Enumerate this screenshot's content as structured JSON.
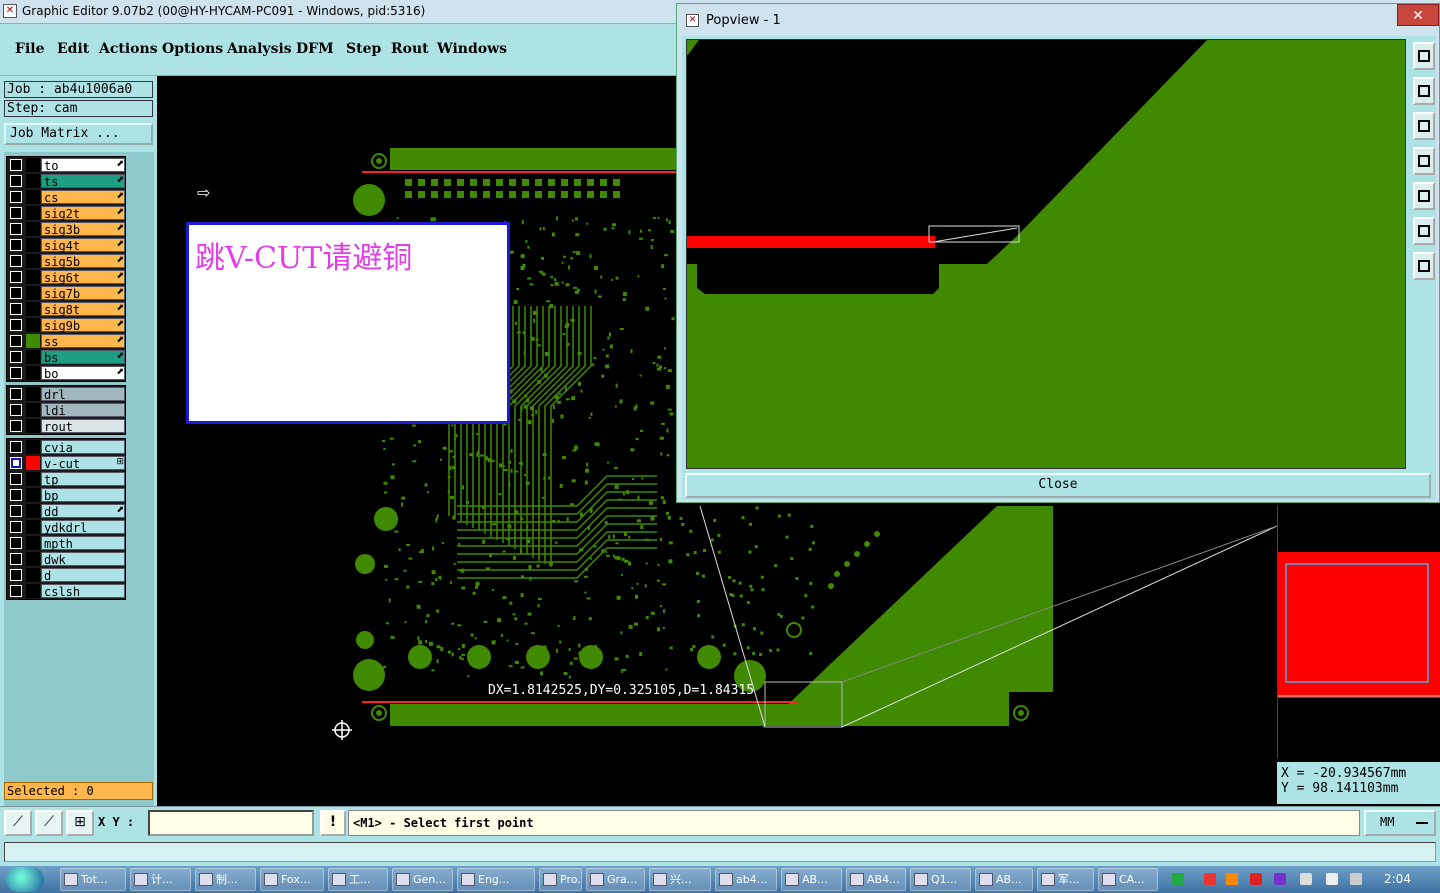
{
  "window": {
    "title": "Graphic Editor 9.07b2 (00@HY-HYCAM-PC091 - Windows, pid:5316)"
  },
  "menu": [
    "File",
    "Edit",
    "Actions",
    "Options",
    "Analysis",
    "DFM",
    "Step",
    "Rout",
    "Windows"
  ],
  "job": {
    "job_line": "Job  : ab4u1006a0",
    "step_line": "Step: cam",
    "matrix_button": "Job Matrix ..."
  },
  "layers": {
    "board": [
      {
        "name": "to",
        "color": "#ffffff",
        "flag": "⬈"
      },
      {
        "name": "ts",
        "color": "#1e9e82",
        "flag": "⬈"
      },
      {
        "name": "cs",
        "color": "#ffb74d",
        "flag": "⬈"
      },
      {
        "name": "sig2t",
        "color": "#ffb74d",
        "flag": "⬈"
      },
      {
        "name": "sig3b",
        "color": "#ffb74d",
        "flag": "⬈"
      },
      {
        "name": "sig4t",
        "color": "#ffb74d",
        "flag": "⬈"
      },
      {
        "name": "sig5b",
        "color": "#ffb74d",
        "flag": "⬈"
      },
      {
        "name": "sig6t",
        "color": "#ffb74d",
        "flag": "⬈"
      },
      {
        "name": "sig7b",
        "color": "#ffb74d",
        "flag": "⬈"
      },
      {
        "name": "sig8t",
        "color": "#ffb74d",
        "flag": "⬈"
      },
      {
        "name": "sig9b",
        "color": "#ffb74d",
        "flag": "⬈"
      },
      {
        "name": "ss",
        "color": "#ffb74d",
        "flag": "⬈"
      },
      {
        "name": "bs",
        "color": "#1e9e82",
        "flag": "⬈"
      },
      {
        "name": "bo",
        "color": "#ffffff",
        "flag": "⬈"
      }
    ],
    "drill": [
      {
        "name": "drl",
        "color": "#9fb7bd",
        "flag": ""
      },
      {
        "name": "ldi",
        "color": "#9fb7bd",
        "flag": ""
      },
      {
        "name": "rout",
        "color": "#d9e4e6",
        "flag": ""
      }
    ],
    "misc": [
      {
        "name": "cvia",
        "color": "#aee3e6",
        "flag": ""
      },
      {
        "name": "v-cut",
        "color": "#aee3e6",
        "flag": "⊞"
      },
      {
        "name": "tp",
        "color": "#aee3e6",
        "flag": ""
      },
      {
        "name": "bp",
        "color": "#aee3e6",
        "flag": ""
      },
      {
        "name": "dd",
        "color": "#aee3e6",
        "flag": "⬈"
      },
      {
        "name": "ydkdrl",
        "color": "#aee3e6",
        "flag": ""
      },
      {
        "name": "mpth",
        "color": "#aee3e6",
        "flag": ""
      },
      {
        "name": "dwk",
        "color": "#aee3e6",
        "flag": ""
      },
      {
        "name": "d",
        "color": "#aee3e6",
        "flag": ""
      },
      {
        "name": "cslsh",
        "color": "#aee3e6",
        "flag": ""
      }
    ],
    "selected_text": "Selected : 0"
  },
  "canvas": {
    "note_text": "跳V-CUT请避铜",
    "measure_text": "DX=1.8142525,DY=0.325105,D=1.84315",
    "copper_color": "#3f8a00",
    "vcut_color": "#ff0000"
  },
  "popview": {
    "title": "Popview - 1",
    "close_button": "Close",
    "close_x": "✕"
  },
  "coords": {
    "x": "X  = -20.934567mm",
    "y": "Y  = 98.141103mm"
  },
  "cmdbar": {
    "xy_label": "X Y :",
    "xy_value": "",
    "prompt": "<M1> - Select first point",
    "units": "MM",
    "warn": "!"
  },
  "taskbar": {
    "items": [
      "Tot...",
      "计...",
      "制...",
      "Fox...",
      "工...",
      "Gen...",
      "Eng...",
      "Pro...",
      "Gra...",
      "兴...",
      "ab4...",
      "AB...",
      "AB4...",
      "Q1...",
      "AB...",
      "军...",
      "CA..."
    ],
    "clock": "2:04"
  }
}
